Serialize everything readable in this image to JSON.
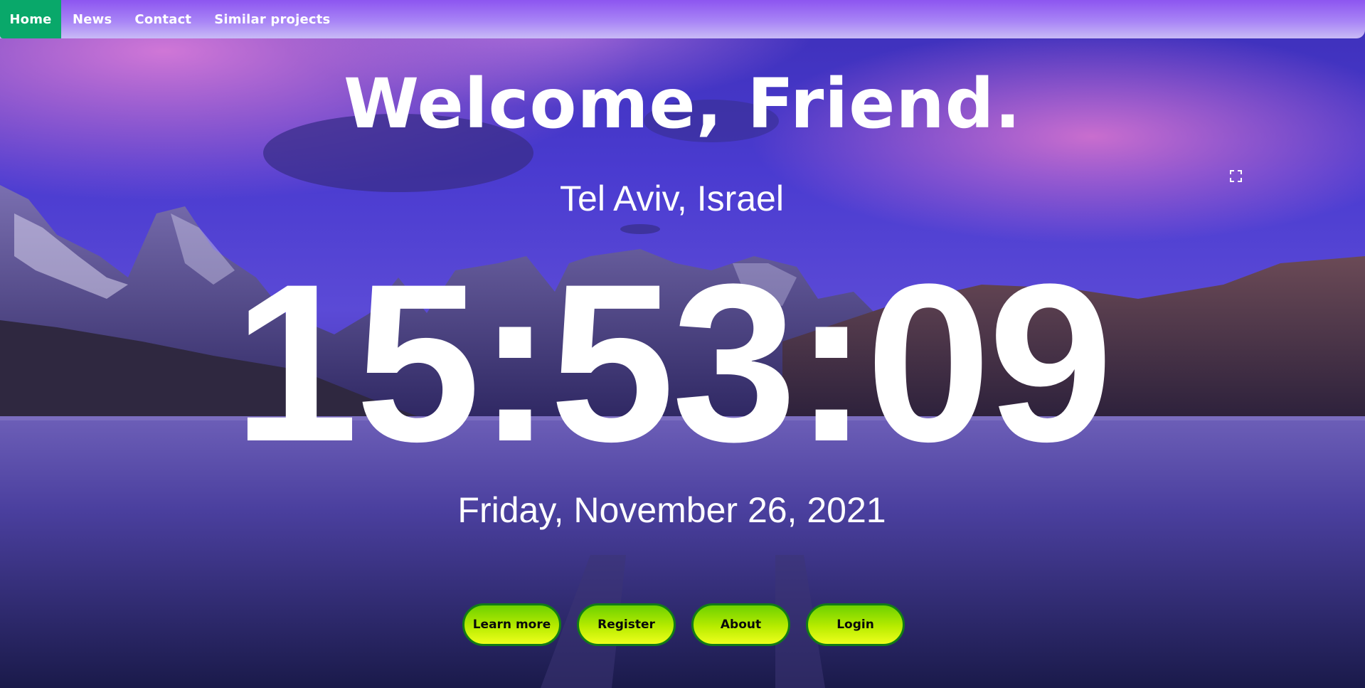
{
  "nav": {
    "items": [
      {
        "label": "Home"
      },
      {
        "label": "News"
      },
      {
        "label": "Contact"
      },
      {
        "label": "Similar projects"
      }
    ]
  },
  "hero": {
    "welcome": "Welcome, Friend.",
    "location": "Tel Aviv, Israel",
    "time": "15:53:09",
    "date": "Friday, November 26, 2021"
  },
  "buttons": [
    {
      "label": "Learn more"
    },
    {
      "label": "Register"
    },
    {
      "label": "About"
    },
    {
      "label": "Login"
    }
  ],
  "icons": {
    "fullscreen": "expand-icon"
  },
  "colors": {
    "nav_active": "#09a86a",
    "nav_gradient_top": "#8d55f0",
    "button_border": "#117c16",
    "button_fill": "#b8ec00"
  }
}
